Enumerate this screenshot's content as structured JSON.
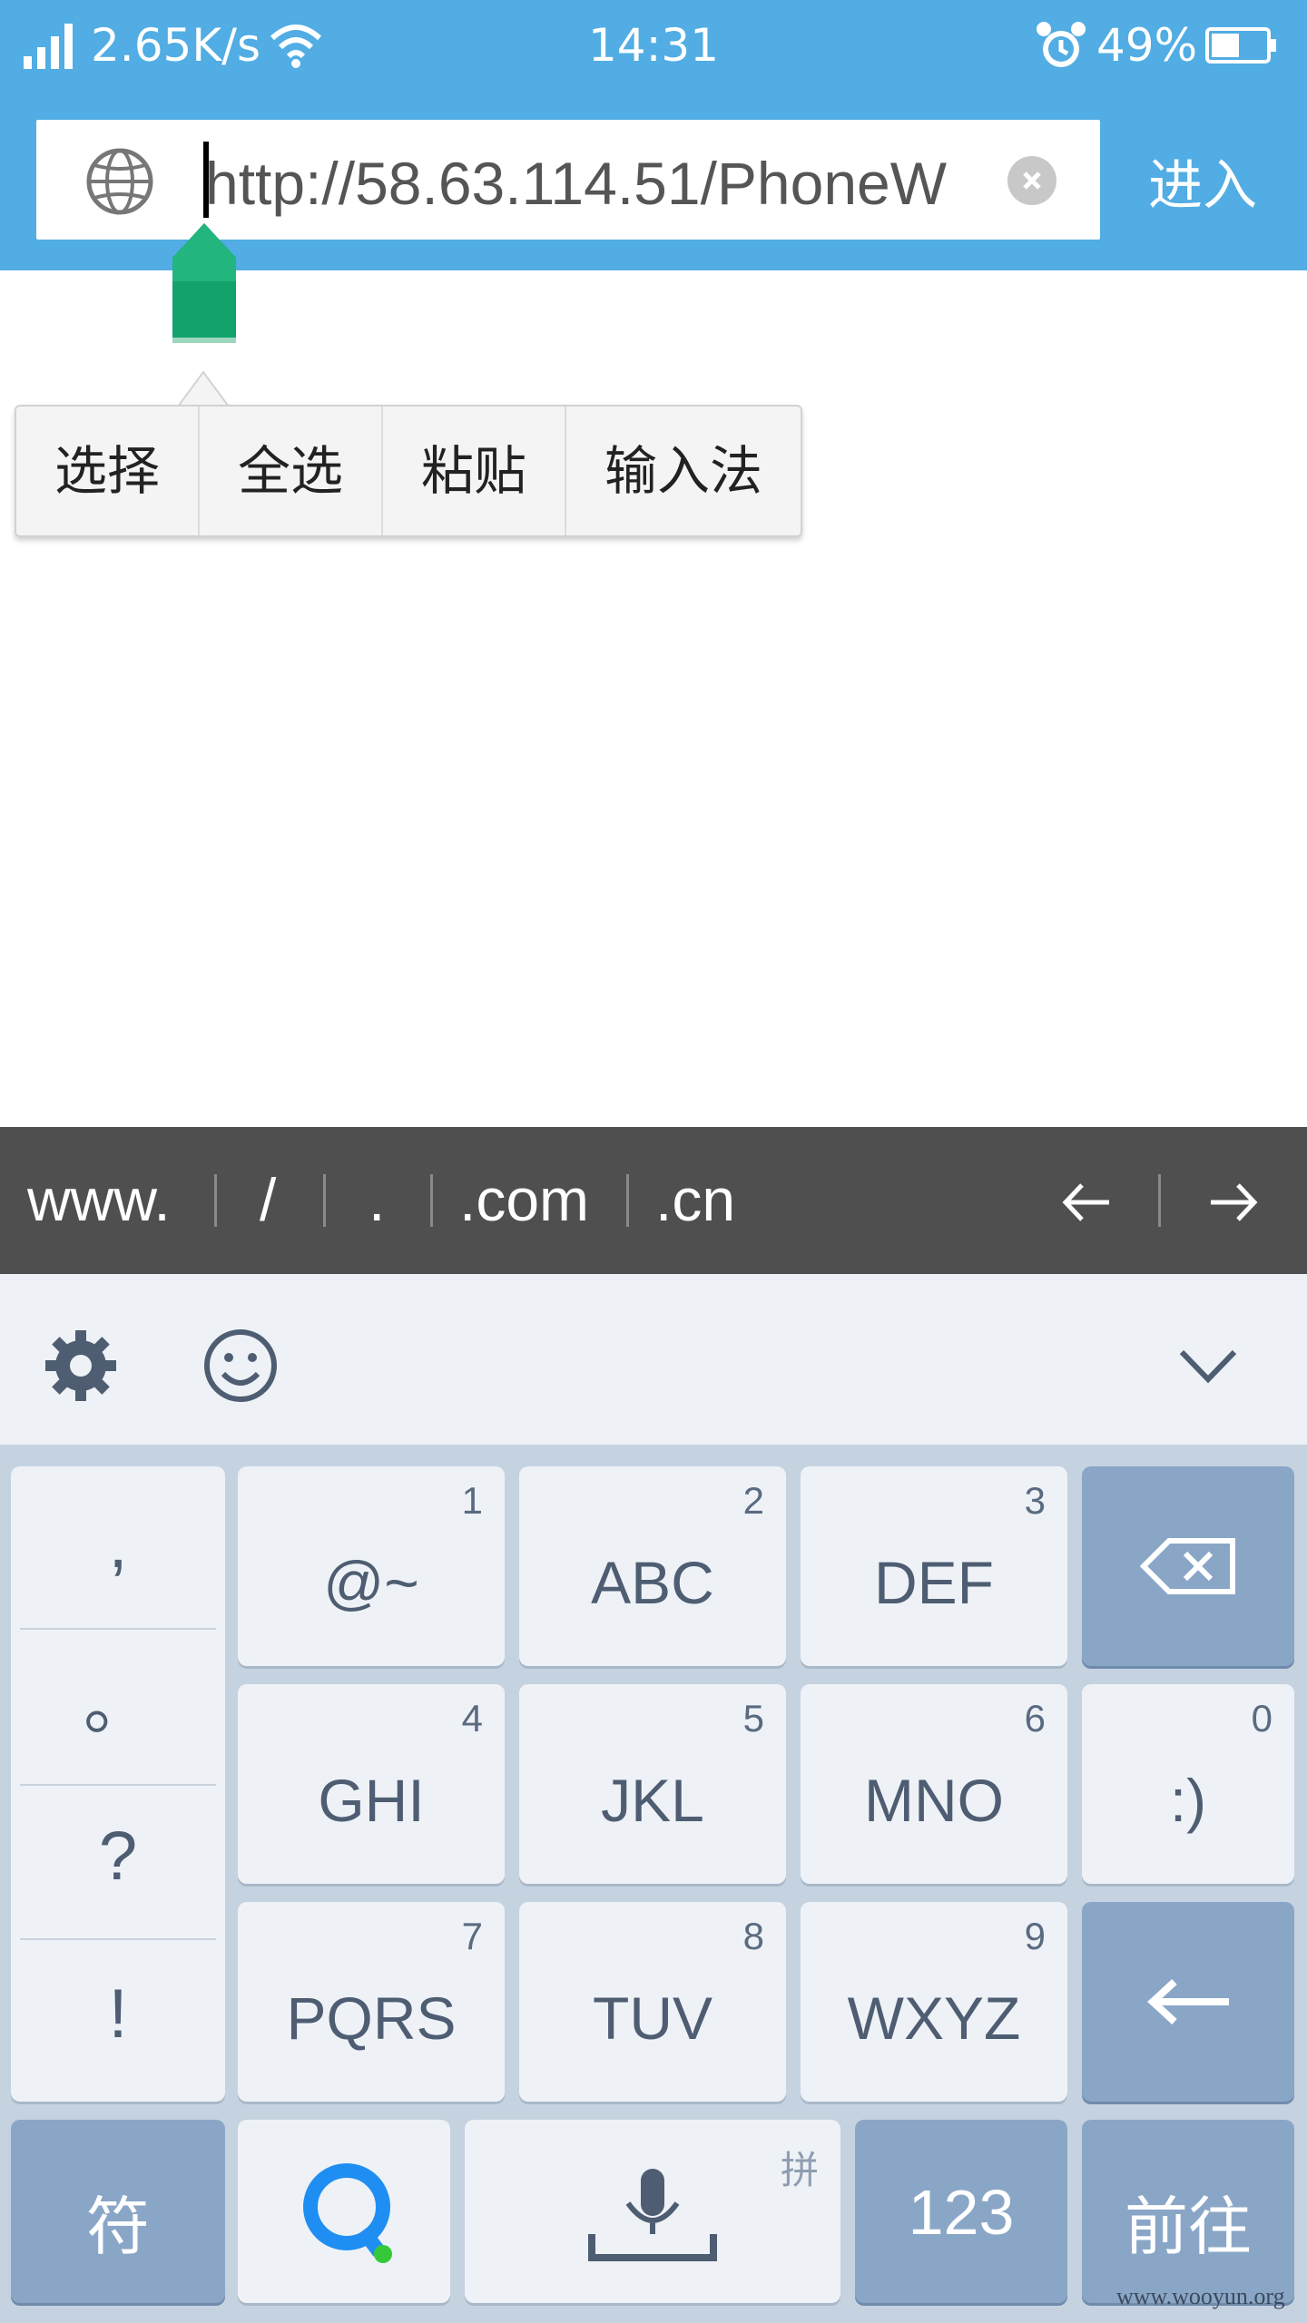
{
  "status": {
    "speed": "2.65K/s",
    "time": "14:31",
    "battery": "49%",
    "icons": [
      "signal-icon",
      "wifi-icon",
      "alarm-icon",
      "battery-icon"
    ]
  },
  "urlbar": {
    "url": "http://58.63.114.51/PhoneW",
    "go_label": "进入"
  },
  "context_menu": [
    "选择",
    "全选",
    "粘贴",
    "输入法"
  ],
  "shortcuts": [
    "www.",
    "/",
    ".",
    ".com",
    ".cn"
  ],
  "keyboard": {
    "punct": [
      ",",
      "。",
      "?",
      "!"
    ],
    "keys": [
      {
        "label": "@~",
        "num": "1"
      },
      {
        "label": "ABC",
        "num": "2"
      },
      {
        "label": "DEF",
        "num": "3"
      },
      {
        "label": "GHI",
        "num": "4"
      },
      {
        "label": "JKL",
        "num": "5"
      },
      {
        "label": "MNO",
        "num": "6"
      },
      {
        "label": ":)",
        "num": "0"
      },
      {
        "label": "PQRS",
        "num": "7"
      },
      {
        "label": "TUV",
        "num": "8"
      },
      {
        "label": "WXYZ",
        "num": "9"
      }
    ],
    "symbols_label": "符",
    "pinyin_label": "拼",
    "numbers_label": "123",
    "go_label": "前往"
  },
  "watermark": "www.wooyun.org",
  "colors": {
    "topbar": "#51ade3",
    "shortcut_bar": "#4f4f4f",
    "key_dark": "#8aa6c7",
    "handle": "#13a26c",
    "logo_blue": "#1f8ef2",
    "logo_green": "#35c93a"
  }
}
